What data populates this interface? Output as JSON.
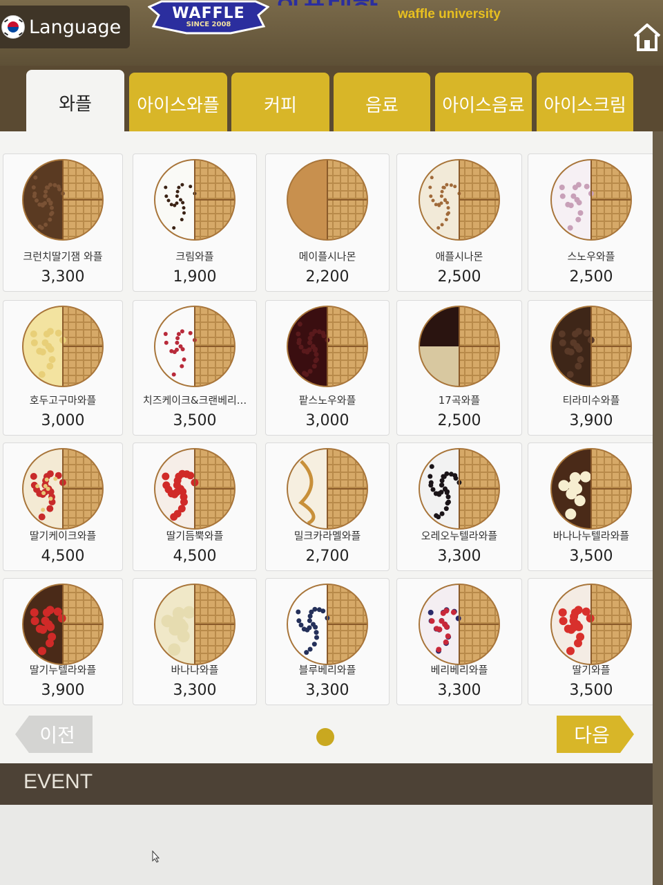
{
  "header": {
    "language_label": "Language",
    "logo_text": "WAFFLE",
    "logo_since": "SINCE 2008",
    "brand_en": "waffle university",
    "brand_ko": "와플대학",
    "home_icon": "home-icon"
  },
  "tabs": [
    {
      "label": "와플",
      "active": true
    },
    {
      "label": "아이스와플",
      "active": false
    },
    {
      "label": "커피",
      "active": false
    },
    {
      "label": "음료",
      "active": false
    },
    {
      "label": "아이스음료",
      "active": false
    },
    {
      "label": "아이스크림",
      "active": false
    }
  ],
  "menu_items": [
    {
      "name": "크런치딸기잼 와플",
      "price": "3,300",
      "topping": "crunch"
    },
    {
      "name": "크림와플",
      "price": "1,900",
      "topping": "cream"
    },
    {
      "name": "메이플시나몬",
      "price": "2,200",
      "topping": "maple"
    },
    {
      "name": "애플시나몬",
      "price": "2,500",
      "topping": "apple"
    },
    {
      "name": "스노우와플",
      "price": "2,500",
      "topping": "snow"
    },
    {
      "name": "호두고구마와플",
      "price": "3,000",
      "topping": "sweetpotato"
    },
    {
      "name": "치즈케이크&크랜베리...",
      "price": "3,500",
      "topping": "cheesecake"
    },
    {
      "name": "팥스노우와플",
      "price": "3,000",
      "topping": "redbean"
    },
    {
      "name": "17곡와플",
      "price": "2,500",
      "topping": "grain"
    },
    {
      "name": "티라미수와플",
      "price": "3,900",
      "topping": "tiramisu"
    },
    {
      "name": "딸기케이크와플",
      "price": "4,500",
      "topping": "strawcake"
    },
    {
      "name": "딸기듬뿍와플",
      "price": "4,500",
      "topping": "strawberry"
    },
    {
      "name": "밀크카라멜와플",
      "price": "2,700",
      "topping": "caramel"
    },
    {
      "name": "오레오누텔라와플",
      "price": "3,300",
      "topping": "oreo"
    },
    {
      "name": "바나나누텔라와플",
      "price": "3,500",
      "topping": "banananutella"
    },
    {
      "name": "딸기누텔라와플",
      "price": "3,900",
      "topping": "strawnutella"
    },
    {
      "name": "바나나와플",
      "price": "3,300",
      "topping": "banana"
    },
    {
      "name": "블루베리와플",
      "price": "3,300",
      "topping": "blueberry"
    },
    {
      "name": "베리베리와플",
      "price": "3,300",
      "topping": "berry"
    },
    {
      "name": "딸기와플",
      "price": "3,500",
      "topping": "strawberry2"
    }
  ],
  "pagination": {
    "prev_label": "이전",
    "next_label": "다음"
  },
  "event": {
    "title": "EVENT"
  },
  "colors": {
    "accent": "#d8b628",
    "header_bg": "#5a4a32",
    "panel_bg": "#f4f4f2",
    "event_bar": "#4d4236"
  }
}
